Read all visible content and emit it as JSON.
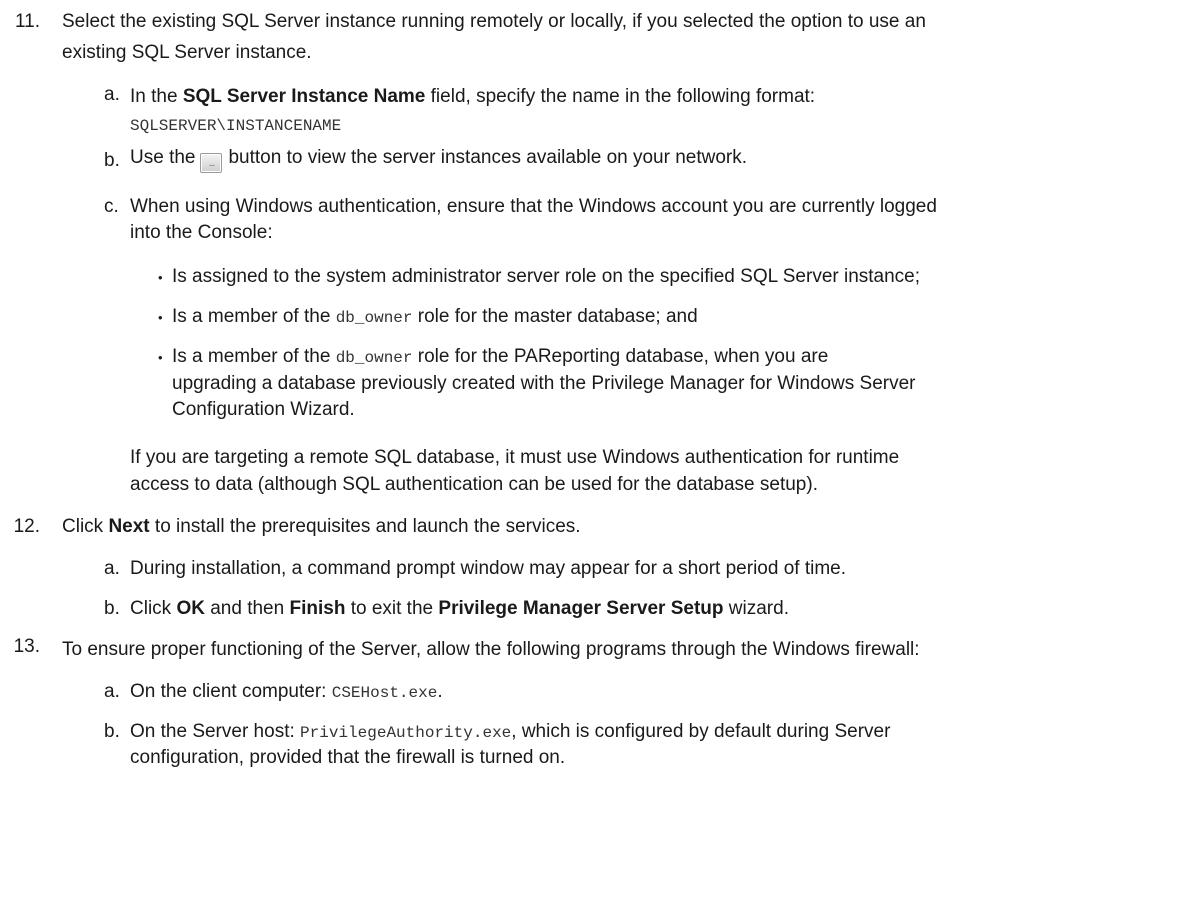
{
  "steps": [
    {
      "num": "11.",
      "line1": "Select the existing SQL Server instance running remotely or locally, if you selected the option to use an",
      "line2": "existing SQL Server instance.",
      "substeps": {
        "a": {
          "label": "a.",
          "t1": "In the ",
          "b1": "SQL Server Instance Name",
          "t2": " field, specify the name in the following format:",
          "code": "SQLSERVER\\INSTANCENAME"
        },
        "b": {
          "label": "b.",
          "t1": "Use the",
          "btn": "...",
          "t2": "button to view the server instances available on your network."
        },
        "c": {
          "label": "c.",
          "line1": "When using Windows authentication, ensure that the Windows account you are currently logged",
          "line2": "into the Console:",
          "bullets": {
            "b1": "Is assigned to the system administrator server role on the specified SQL Server instance;",
            "b2": {
              "t1": "Is a member of the ",
              "code": "db_owner",
              "t2": " role for the master database; and"
            },
            "b3": {
              "t1": "Is a member of the ",
              "code": "db_owner",
              "t2": "  role for the PAReporting database, when you are",
              "line2": "upgrading a database previously created with the Privilege Manager for Windows Server",
              "line3": "Configuration Wizard."
            }
          }
        }
      },
      "note1": "If you are targeting a remote SQL database, it must use Windows authentication for runtime",
      "note2": "access to data (although SQL authentication can be used for the database setup)."
    },
    {
      "num": "12.",
      "t1": "Click ",
      "b1": "Next",
      "t2": " to install the prerequisites and launch the services.",
      "substeps": {
        "a": {
          "label": "a.",
          "text": "During installation, a command prompt window may appear for a short period of time."
        },
        "b": {
          "label": "b.",
          "t1": "Click ",
          "b1": "OK",
          "t2": " and then ",
          "b2": "Finish",
          "t3": " to exit the ",
          "b3": "Privilege Manager Server Setup",
          "t4": " wizard."
        }
      }
    },
    {
      "num": "13.",
      "line1": "To ensure proper functioning of the Server, allow the following programs through the Windows firewall:",
      "substeps": {
        "a": {
          "label": "a.",
          "t1": "On the client computer: ",
          "code": "CSEHost.exe",
          "t2": "."
        },
        "b": {
          "label": "b.",
          "t1": "On the Server host: ",
          "code": "PrivilegeAuthority.exe",
          "t2": ", which is configured by default during Server",
          "line2": "configuration, provided that the firewall is turned on."
        }
      }
    }
  ],
  "icons": {
    "bullet": "•"
  }
}
